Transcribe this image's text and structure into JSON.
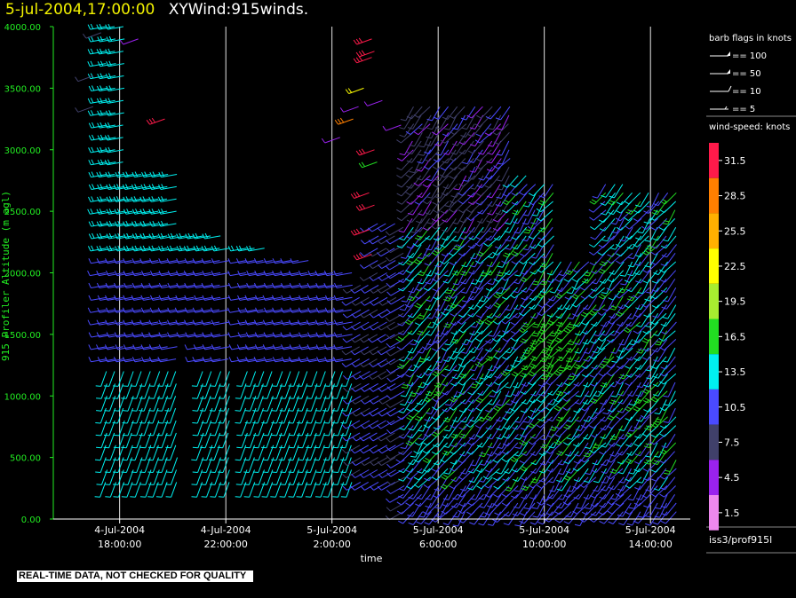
{
  "header": {
    "timestamp": "5-jul-2004,17:00:00",
    "title": "XYWind:915winds."
  },
  "footer_note": "REAL-TIME DATA, NOT CHECKED FOR QUALITY",
  "station_label": "iss3/prof915l",
  "barb_legend": {
    "title": "barb flags in knots",
    "items": [
      "== 100",
      "== 50",
      "== 10",
      "== 5"
    ]
  },
  "colorbar": {
    "title": "wind-speed: knots",
    "levels": [
      {
        "label": "31.5",
        "color": "#ff1a4a"
      },
      {
        "label": "28.5",
        "color": "#ff7f00"
      },
      {
        "label": "25.5",
        "color": "#ffb000"
      },
      {
        "label": "22.5",
        "color": "#ffff00"
      },
      {
        "label": "19.5",
        "color": "#a8ee30"
      },
      {
        "label": "16.5",
        "color": "#22dd22"
      },
      {
        "label": "13.5",
        "color": "#00f0f0"
      },
      {
        "label": "10.5",
        "color": "#4a4aff"
      },
      {
        "label": "7.5",
        "color": "#40406a"
      },
      {
        "label": "4.5",
        "color": "#9a22ee"
      },
      {
        "label": "1.5",
        "color": "#ee88ee"
      }
    ]
  },
  "chart_data": {
    "type": "scatter",
    "plot_kind": "wind barbs (time-height)",
    "ylabel": "915 Profiler Altitude (m agl)",
    "xlabel": "time",
    "ylim": [
      0,
      4000
    ],
    "xlim_hours": [
      15.5,
      39.5
    ],
    "yticks": [
      "0.00",
      "500.00",
      "1000.00",
      "1500.00",
      "2000.00",
      "2500.00",
      "3000.00",
      "3500.00",
      "4000.00"
    ],
    "xticks": [
      {
        "hour": 18,
        "date": "4-Jul-2004",
        "time": "18:00:00"
      },
      {
        "hour": 22,
        "date": "4-Jul-2004",
        "time": "22:00:00"
      },
      {
        "hour": 26,
        "date": "5-Jul-2004",
        "time": "2:00:00"
      },
      {
        "hour": 30,
        "date": "5-Jul-2004",
        "time": "6:00:00"
      },
      {
        "hour": 34,
        "date": "5-Jul-2004",
        "time": "10:00:00"
      },
      {
        "hour": 38,
        "date": "5-Jul-2004",
        "time": "14:00:00"
      }
    ],
    "grid": "vertical lines at x ticks"
  }
}
